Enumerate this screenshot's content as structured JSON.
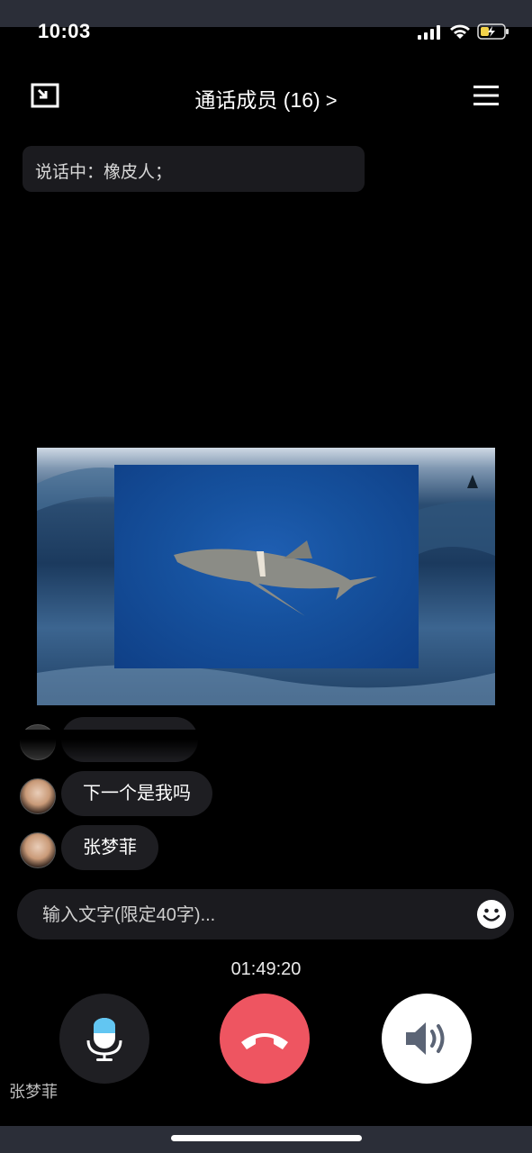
{
  "status_bar": {
    "time": "10:03"
  },
  "header": {
    "title": "通话成员 (16)",
    "chevron": ">"
  },
  "speaking": {
    "text": "说话中：橡皮人；"
  },
  "chat": {
    "messages": [
      {
        "text": "下一个是我吗"
      },
      {
        "text": "张梦菲"
      }
    ]
  },
  "input": {
    "placeholder": "输入文字(限定40字)..."
  },
  "call": {
    "duration": "01:49:20",
    "caller_name": "张梦菲"
  },
  "colors": {
    "hangup": "#ee5561",
    "mic_accent": "#62c6f2",
    "speaker_icon": "#5b6475"
  },
  "icons": [
    "exit-fullscreen-icon",
    "menu-icon",
    "emoji-icon",
    "microphone-icon",
    "hang-up-icon",
    "speaker-icon"
  ]
}
